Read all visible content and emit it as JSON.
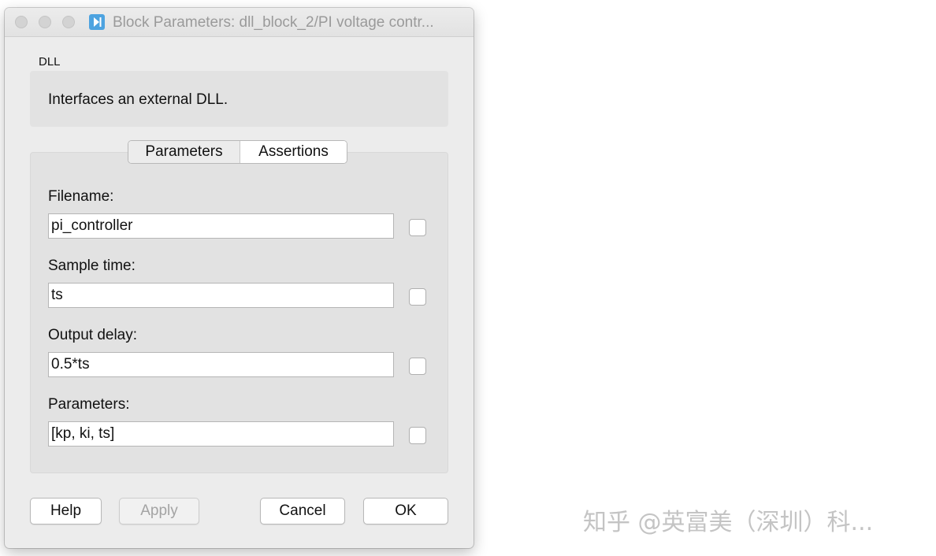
{
  "window": {
    "title": "Block Parameters: dll_block_2/PI voltage contr..."
  },
  "block": {
    "type": "DLL",
    "description": "Interfaces an external DLL."
  },
  "tabs": [
    {
      "label": "Parameters",
      "selected": true
    },
    {
      "label": "Assertions",
      "selected": false
    }
  ],
  "fields": [
    {
      "label": "Filename:",
      "value": "pi_controller",
      "checked": false
    },
    {
      "label": "Sample time:",
      "value": "ts",
      "checked": false
    },
    {
      "label": "Output delay:",
      "value": "0.5*ts",
      "checked": false
    },
    {
      "label": "Parameters:",
      "value": "[kp, ki, ts]",
      "checked": false
    }
  ],
  "buttons": {
    "help": "Help",
    "apply": "Apply",
    "cancel": "Cancel",
    "ok": "OK"
  },
  "watermark": "知乎 @英富美（深圳）科...",
  "icons": {
    "app": "play-step-icon"
  }
}
